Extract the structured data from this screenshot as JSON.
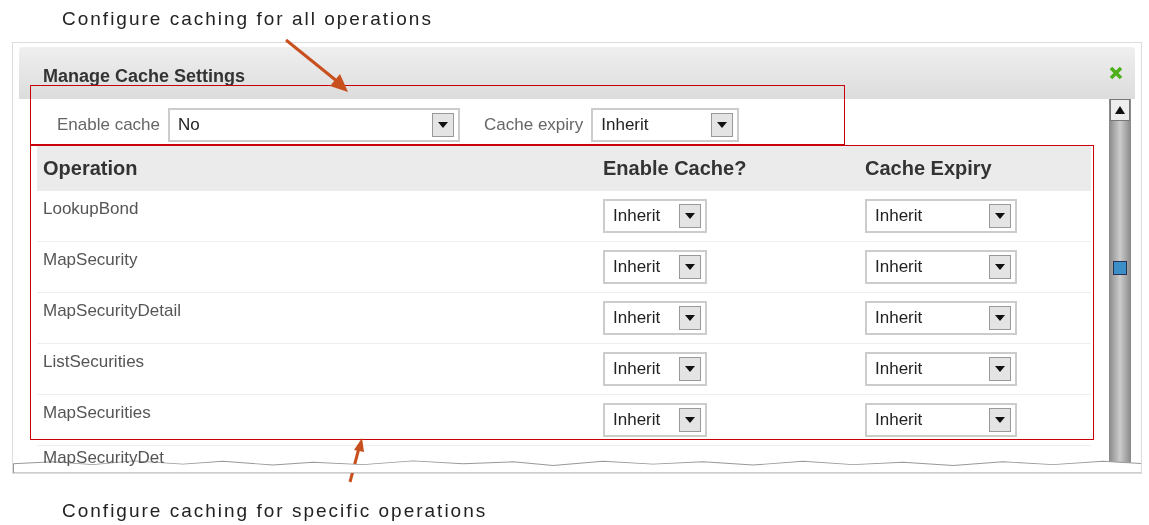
{
  "annotations": {
    "top": "Configure caching for all operations",
    "bottom": "Configure caching for specific operations"
  },
  "dialog": {
    "title": "Manage Cache Settings",
    "global": {
      "enable_label": "Enable cache",
      "enable_value": "No",
      "expiry_label": "Cache expiry",
      "expiry_value": "Inherit"
    },
    "table": {
      "columns": [
        "Operation",
        "Enable Cache?",
        "Cache Expiry"
      ],
      "rows": [
        {
          "operation": "LookupBond",
          "enable": "Inherit",
          "expiry": "Inherit"
        },
        {
          "operation": "MapSecurity",
          "enable": "Inherit",
          "expiry": "Inherit"
        },
        {
          "operation": "MapSecurityDetail",
          "enable": "Inherit",
          "expiry": "Inherit"
        },
        {
          "operation": "ListSecurities",
          "enable": "Inherit",
          "expiry": "Inherit"
        },
        {
          "operation": "MapSecurities",
          "enable": "Inherit",
          "expiry": "Inherit"
        }
      ],
      "partial_row": "MapSecurityDet"
    }
  }
}
